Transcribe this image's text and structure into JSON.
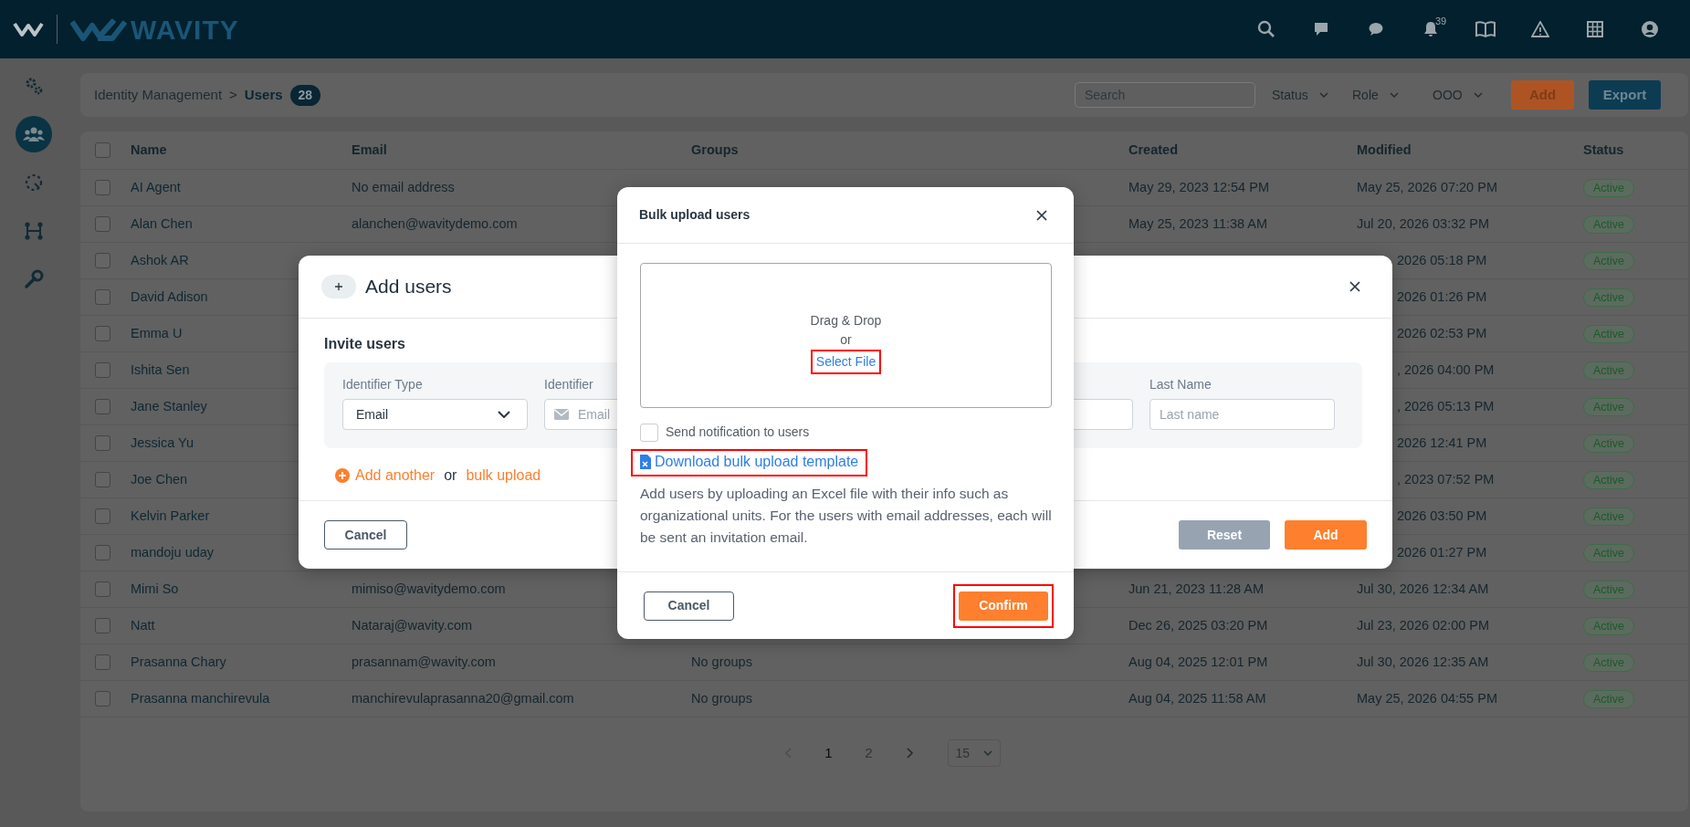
{
  "topbar": {
    "logo_text": "WAVITY",
    "notifications_count": "39"
  },
  "sidebar": {
    "items": [
      {
        "kind": "settings",
        "selected": false
      },
      {
        "kind": "users",
        "selected": true
      },
      {
        "kind": "dashed",
        "selected": false
      },
      {
        "kind": "flow",
        "selected": false
      },
      {
        "kind": "tools",
        "selected": false
      }
    ]
  },
  "breadcrumb": {
    "parent": "Identity Management",
    "separator": ">",
    "current": "Users",
    "count": "28"
  },
  "toolbar": {
    "search": {
      "placeholder": "Search"
    },
    "filters": [
      "Status",
      "Role",
      "OOO"
    ],
    "add_button": "Add",
    "export_button": "Export"
  },
  "table": {
    "select_all_checked": false,
    "columns": [
      "Name",
      "Email",
      "Groups",
      "Created",
      "Modified",
      "Status"
    ],
    "rows": [
      {
        "checked": false,
        "name": "AI Agent",
        "email": "No email address",
        "created": "May 29, 2023 12:54 PM",
        "modified": "May 25, 2026 07:20 PM",
        "status": "Active"
      },
      {
        "checked": false,
        "name": "Alan Chen",
        "email": "alanchen@wavitydemo.com",
        "created": "May 25, 2023 11:38 AM",
        "modified": "Jul 20, 2026 03:32 PM",
        "status": "Active"
      },
      {
        "checked": false,
        "name": "Ashok AR",
        "modified_tail": "2026 05:18 PM",
        "status": "Active"
      },
      {
        "checked": false,
        "name": "David Adison",
        "modified_tail": "2026 01:26 PM",
        "status": "Active"
      },
      {
        "checked": false,
        "name": "Emma U",
        "modified_tail": "2026 02:53 PM",
        "status": "Active"
      },
      {
        "checked": false,
        "name": "Ishita Sen",
        "modified_tail": ", 2026 04:00 PM",
        "status": "Active"
      },
      {
        "checked": false,
        "name": "Jane Stanley",
        "modified_tail": ", 2026 05:13 PM",
        "status": "Active"
      },
      {
        "checked": false,
        "name": "Jessica Yu",
        "modified_tail": "2026 12:41 PM",
        "status": "Active"
      },
      {
        "checked": false,
        "name": "Joe Chen",
        "modified_tail": ", 2023 07:52 PM",
        "status": "Active"
      },
      {
        "checked": false,
        "name": "Kelvin Parker",
        "modified_tail": "2026 03:50 PM",
        "status": "Active"
      },
      {
        "checked": false,
        "name": "mandoju uday",
        "modified_tail": "2026 01:27 PM",
        "status": "Active"
      },
      {
        "checked": false,
        "name": "Mimi So",
        "email": "mimiso@wavitydemo.com",
        "created": "Jun 21, 2023 11:28 AM",
        "modified": "Jul 30, 2026 12:34 AM",
        "status": "Active"
      },
      {
        "checked": false,
        "name": "Natt",
        "email": "Nataraj@wavity.com",
        "created": "Dec 26, 2025 03:20 PM",
        "modified": "Jul 23, 2026 02:00 PM",
        "status": "Active"
      },
      {
        "checked": false,
        "name": "Prasanna Chary",
        "email": "prasannam@wavity.com",
        "groups": "No groups",
        "created": "Aug 04, 2025 12:01 PM",
        "modified": "Jul 30, 2026 12:35 AM",
        "status": "Active"
      },
      {
        "checked": false,
        "name": "Prasanna manchirevula",
        "email": "manchirevulaprasanna20@gmail.com",
        "groups": "No groups",
        "created": "Aug 04, 2025 11:58 AM",
        "modified": "May 25, 2026 04:55 PM",
        "status": "Active"
      }
    ]
  },
  "pagination": {
    "pages": [
      {
        "label": "1",
        "selected": true
      },
      {
        "label": "2",
        "selected": false
      }
    ],
    "page_size": "15"
  },
  "add_users_modal": {
    "title": "Add users",
    "section_title": "Invite users",
    "fields": [
      {
        "kind": "select",
        "label": "Identifier Type",
        "value": "Email"
      },
      {
        "kind": "email",
        "label": "Identifier",
        "placeholder": "Email"
      },
      {
        "kind": "input"
      },
      {
        "kind": "input",
        "label": "Last Name",
        "placeholder": "Last name"
      }
    ],
    "add_another": "Add another",
    "or": "or",
    "bulk_upload": "bulk upload",
    "cancel": "Cancel",
    "reset": {
      "label": "Reset",
      "disabled": true
    },
    "add": "Add"
  },
  "bulk_upload_modal": {
    "title": "Bulk upload users",
    "drop_text": "Drag & Drop",
    "or": "or",
    "select_file": {
      "label": "Select File",
      "highlighted": true
    },
    "notify": {
      "label": "Send notification to users",
      "checked": false
    },
    "download": {
      "label": "Download bulk upload template",
      "highlighted": true
    },
    "description": "Add users by uploading an Excel file with their info such as organizational units. For the users with email addresses, each will be sent an invitation email.",
    "cancel": "Cancel",
    "confirm": {
      "label": "Confirm",
      "highlighted": true
    }
  }
}
